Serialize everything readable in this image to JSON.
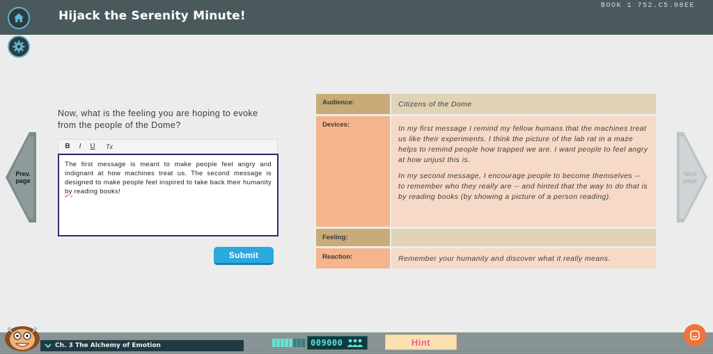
{
  "header": {
    "title": "Hijack the Serenity Minute!",
    "book_code": "BOOK 1 752.C5.08EE",
    "home_icon": "home-icon",
    "settings_icon": "gear-icon"
  },
  "nav": {
    "prev_label_1": "Prev.",
    "prev_label_2": "page",
    "next_label_1": "Next",
    "next_label_2": "page"
  },
  "question": {
    "prompt": "Now, what is the feeling you are hoping to evoke from the people of the Dome?"
  },
  "editor": {
    "bold": "B",
    "italic": "I",
    "underline": "U",
    "clear_format": "Tx",
    "text_before": "The first message is meant to make people feel angry and indignant at how machines treat us. The second message is designed to make people feel inspired to take back their humanity ",
    "misspelled_word": "by",
    "text_after": " reading books!"
  },
  "submit_label": "Submit",
  "info_table": {
    "audience_label": "Audience:",
    "audience_value": "Citizens of the Dome",
    "devices_label": "Devices:",
    "devices_p1": "In my first message I remind my fellow humans that the machines treat us like their experiments. I think the picture of the lab rat in a maze helps to remind people how trapped we are. I want people to feel angry at how unjust this is.",
    "devices_p2": "In my second message, I encourage people to become themselves -- to remember who they really are -- and hinted that the way to do that is by reading books (by showing a picture of a person reading).",
    "feeling_label": "Feeling:",
    "feeling_value": "",
    "reaction_label": "Reaction:",
    "reaction_value": "Remember your humanity and discover what it really means."
  },
  "footer": {
    "chapter": "Ch. 3 The Alchemy of Emotion",
    "score": "009000",
    "hint_label": "Hint",
    "chat_icon": "chat-icon"
  },
  "colors": {
    "accent_blue": "#29a9e0",
    "header_bg": "#4a5a5c",
    "audience_label_bg": "#c8ab78",
    "devices_label_bg": "#f5b48b",
    "hint_text": "#f05a8c"
  }
}
